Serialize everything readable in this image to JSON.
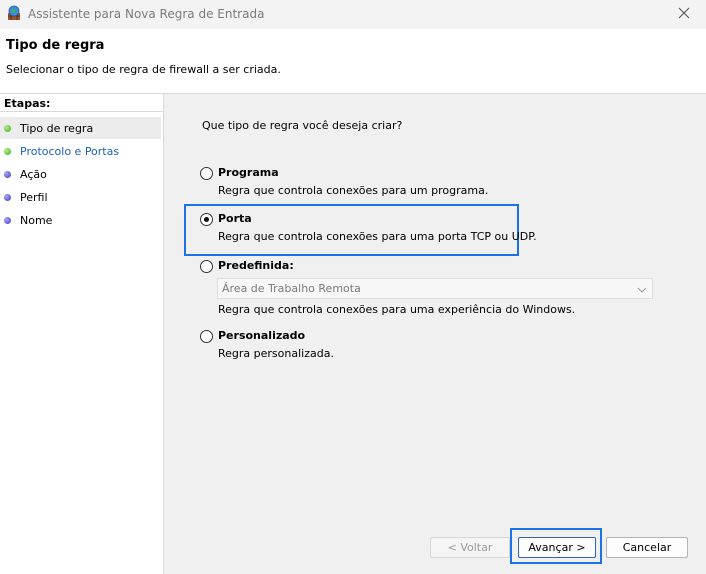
{
  "window": {
    "title": "Assistente para Nova Regra de Entrada",
    "icons": {
      "app": "firewall-wizard-icon",
      "close": "close-icon"
    }
  },
  "header": {
    "title": "Tipo de regra",
    "description": "Selecionar o tipo de regra de firewall a ser criada."
  },
  "sidebar": {
    "label": "Etapas:",
    "steps": [
      {
        "label": "Tipo de regra",
        "status": "green",
        "active": true
      },
      {
        "label": "Protocolo e Portas",
        "status": "green",
        "active": false
      },
      {
        "label": "Ação",
        "status": "blue",
        "active": false
      },
      {
        "label": "Perfil",
        "status": "blue",
        "active": false
      },
      {
        "label": "Nome",
        "status": "blue",
        "active": false
      }
    ]
  },
  "main": {
    "question": "Que tipo de regra você deseja criar?",
    "options": [
      {
        "title": "Programa",
        "description": "Regra que controla conexões para um programa.",
        "checked": false
      },
      {
        "title": "Porta",
        "description": "Regra que controla conexões para uma porta TCP ou UDP.",
        "checked": true
      },
      {
        "title": "Predefinida:",
        "description": "Regra que controla conexões para uma experiência do Windows.",
        "checked": false
      },
      {
        "title": "Personalizado",
        "description": "Regra personalizada.",
        "checked": false
      }
    ],
    "predefined_dropdown": {
      "value": "Área de Trabalho Remota",
      "disabled": true
    }
  },
  "buttons": {
    "back": "< Voltar",
    "next": "Avançar >",
    "cancel": "Cancelar"
  },
  "colors": {
    "highlight": "#1a73e8",
    "link": "#1c62b9",
    "step_done": "#3aa81c",
    "step_pending": "#3b36b8"
  }
}
